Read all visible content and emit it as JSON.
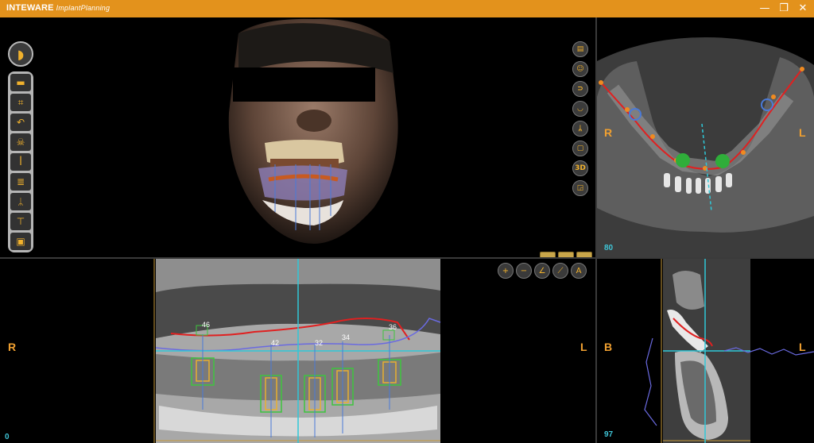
{
  "titlebar": {
    "brand": "INTEWARE",
    "subtitle": "ImplantPlanning",
    "minimize": "—",
    "maximize": "❐",
    "close": "✕"
  },
  "toolbar": {
    "main_icon": "tooth-icon",
    "tools": [
      {
        "icon": "folder-icon",
        "glyph": "▬"
      },
      {
        "icon": "crop-icon",
        "glyph": "⌗"
      },
      {
        "icon": "curve-icon",
        "glyph": "↶"
      },
      {
        "icon": "skull-icon",
        "glyph": "☠"
      },
      {
        "icon": "teeth-icon",
        "glyph": "ꟾ"
      },
      {
        "icon": "implant-icon",
        "glyph": "≣"
      },
      {
        "icon": "nerve-icon",
        "glyph": "ᛦ"
      },
      {
        "icon": "abutment-icon",
        "glyph": "⊤"
      },
      {
        "icon": "save-icon",
        "glyph": "▣"
      }
    ]
  },
  "view3d_tools": [
    {
      "icon": "layout-icon",
      "glyph": "▤"
    },
    {
      "icon": "face-icon",
      "glyph": "☺"
    },
    {
      "icon": "panorex-icon",
      "glyph": "⊃"
    },
    {
      "icon": "tooth-view-icon",
      "glyph": "◡"
    },
    {
      "icon": "nerve-view-icon",
      "glyph": "ᛦ"
    },
    {
      "icon": "measure-view-icon",
      "glyph": "▢"
    },
    {
      "icon": "3d-icon",
      "glyph": "3D"
    },
    {
      "icon": "export-icon",
      "glyph": "◲"
    }
  ],
  "teeth_view_buttons": [
    "▥",
    "▥",
    "▥"
  ],
  "zoom_tools": [
    {
      "icon": "zoom-in-icon",
      "glyph": "+"
    },
    {
      "icon": "zoom-out-icon",
      "glyph": "−"
    },
    {
      "icon": "angle-icon",
      "glyph": "∠"
    },
    {
      "icon": "ruler-icon",
      "glyph": "⟋"
    },
    {
      "icon": "auto-icon",
      "glyph": "A"
    }
  ],
  "axial": {
    "left": "R",
    "right": "L",
    "slice": "80"
  },
  "panoramic": {
    "left": "R",
    "right": "L",
    "slice": "0",
    "teeth": [
      "46",
      "42",
      "32",
      "34",
      "36"
    ]
  },
  "cross_section": {
    "left": "B",
    "right": "L",
    "slice": "97"
  },
  "colors": {
    "accent": "#e3921c",
    "label": "#f0a030",
    "slice": "#3fc4d6",
    "crosshair": "#2fc8d8",
    "implant_outer": "#3ec43e",
    "implant_inner": "#e8b030",
    "nerve": "#e02020"
  }
}
